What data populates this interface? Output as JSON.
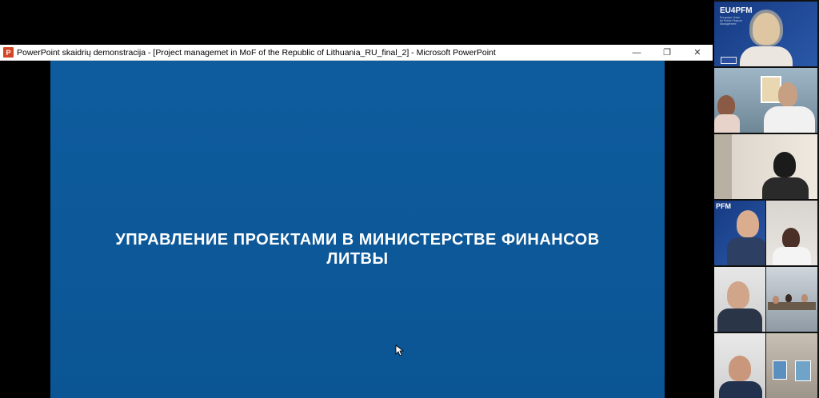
{
  "window": {
    "app_icon_letter": "P",
    "title": "PowerPoint skaidrių demonstracija - [Project managemet in MoF of the Republic of Lithuania_RU_final_2] - Microsoft PowerPoint",
    "controls": {
      "minimize": "—",
      "restore": "❐",
      "close": "✕"
    }
  },
  "slide": {
    "title_line1": "УПРАВЛЕНИЕ ПРОЕКТАМИ В МИНИСТЕРСТВЕ ФИНАНСОВ",
    "title_line2": "ЛИТВЫ"
  },
  "participants": {
    "branding": "EU4PFM",
    "branding_short": "PFM",
    "branding_tagline": "European Union for Public Finance Management"
  },
  "colors": {
    "slide_bg": "#0b5594",
    "eu_blue": "#1d3f87",
    "powerpoint_orange": "#d24726"
  },
  "icons": [
    "powerpoint-icon",
    "minimize-icon",
    "restore-icon",
    "close-icon",
    "mouse-pointer-icon"
  ]
}
